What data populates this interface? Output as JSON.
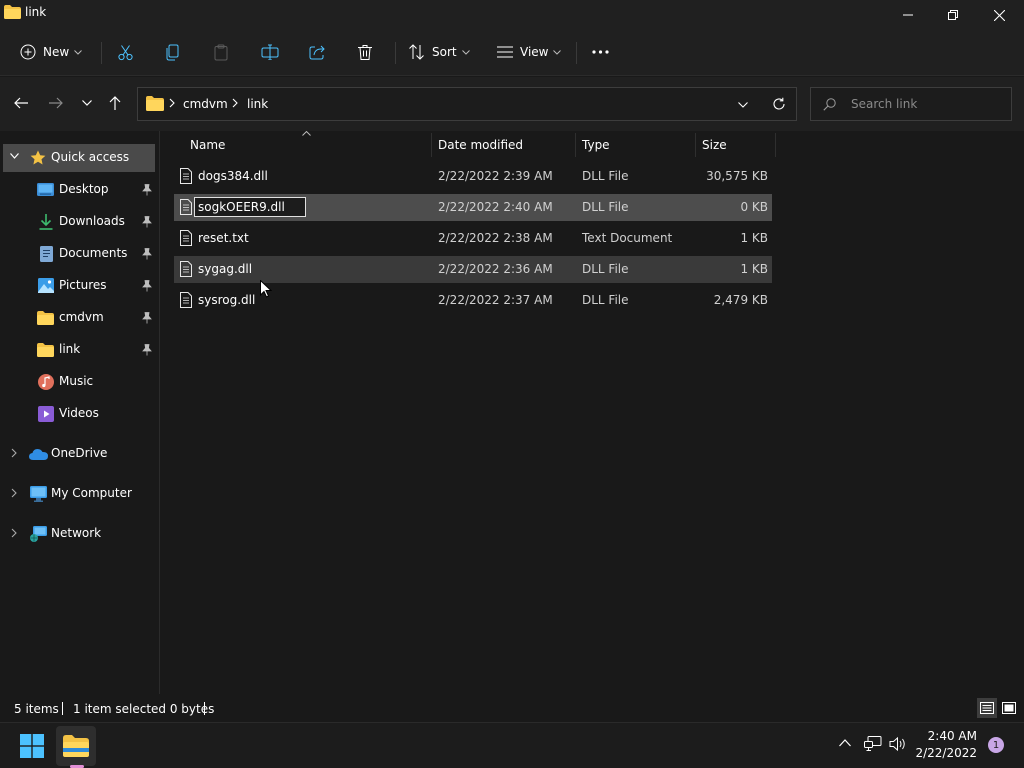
{
  "window": {
    "title": "link",
    "minimize_icon": "minimize-icon",
    "maximize_icon": "restore-icon",
    "close_icon": "close-icon"
  },
  "toolbar": {
    "new_label": "New",
    "sort_label": "Sort",
    "view_label": "View"
  },
  "address": {
    "crumbs": [
      "cmdvm",
      "link"
    ]
  },
  "search": {
    "placeholder": "Search link"
  },
  "sidebar": {
    "quick_access": "Quick access",
    "items": [
      {
        "label": "Desktop",
        "icon": "desktop-icon",
        "pinned": true
      },
      {
        "label": "Downloads",
        "icon": "downloads-icon",
        "pinned": true
      },
      {
        "label": "Documents",
        "icon": "documents-icon",
        "pinned": true
      },
      {
        "label": "Pictures",
        "icon": "pictures-icon",
        "pinned": true
      },
      {
        "label": "cmdvm",
        "icon": "folder-icon",
        "pinned": true
      },
      {
        "label": "link",
        "icon": "folder-icon",
        "pinned": true
      },
      {
        "label": "Music",
        "icon": "music-icon",
        "pinned": false
      },
      {
        "label": "Videos",
        "icon": "videos-icon",
        "pinned": false
      }
    ],
    "onedrive": "OneDrive",
    "my_computer": "My Computer",
    "network": "Network"
  },
  "columns": {
    "name": "Name",
    "date": "Date modified",
    "type": "Type",
    "size": "Size"
  },
  "files": [
    {
      "name": "dogs384.dll",
      "date": "2/22/2022 2:39 AM",
      "type": "DLL File",
      "size": "30,575 KB"
    },
    {
      "name": "sogkOEER9.dll",
      "date": "2/22/2022 2:40 AM",
      "type": "DLL File",
      "size": "0 KB"
    },
    {
      "name": "reset.txt",
      "date": "2/22/2022 2:38 AM",
      "type": "Text Document",
      "size": "1 KB"
    },
    {
      "name": "sygag.dll",
      "date": "2/22/2022 2:36 AM",
      "type": "DLL File",
      "size": "1 KB"
    },
    {
      "name": "sysrog.dll",
      "date": "2/22/2022 2:37 AM",
      "type": "DLL File",
      "size": "2,479 KB"
    }
  ],
  "rename_value": "sogkOEER9.dll",
  "status": {
    "count": "5 items",
    "selection": "1 item selected  0 bytes"
  },
  "taskbar": {
    "time": "2:40 AM",
    "date": "2/22/2022",
    "notifications": "1"
  },
  "colors": {
    "folder": "#f3c245",
    "accent": "#4cc2ff",
    "selected_row": "#4d4d4d"
  }
}
